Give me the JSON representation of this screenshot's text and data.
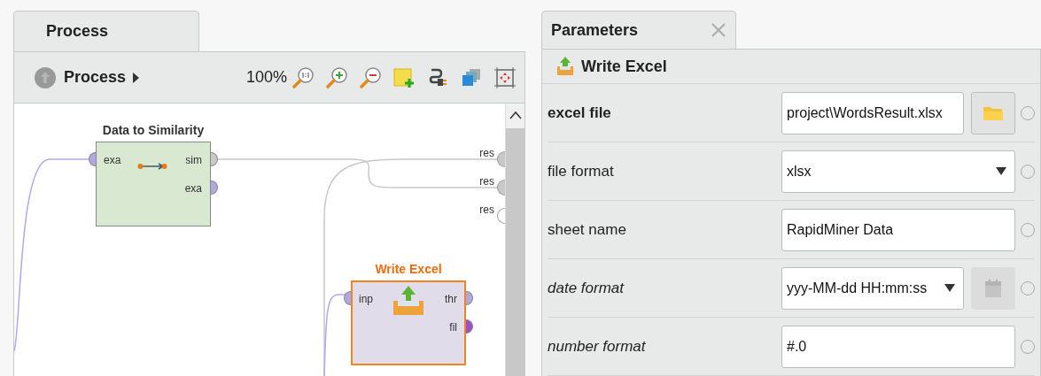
{
  "process_panel": {
    "tab": "Process",
    "toolbar": {
      "breadcrumb": "Process",
      "zoom": "100%"
    },
    "operators": [
      {
        "title": "Data to Similarity",
        "kind": "similarity",
        "selected": false,
        "inputs": [
          {
            "label": "exa",
            "color": "#b0a8e0"
          }
        ],
        "outputs": [
          {
            "label": "sim",
            "color": "#c8c8c8"
          },
          {
            "label": "exa",
            "color": "#b0a8e0"
          }
        ]
      },
      {
        "title": "Write Excel",
        "kind": "write",
        "selected": true,
        "inputs": [
          {
            "label": "inp",
            "color": "#b0a8e0"
          }
        ],
        "outputs": [
          {
            "label": "thr",
            "color": "#b0a8e0"
          },
          {
            "label": "fil",
            "color": "#9a4fc8"
          }
        ]
      }
    ],
    "result_ports": [
      {
        "label": "res",
        "connected": true
      },
      {
        "label": "res",
        "connected": true
      },
      {
        "label": "res",
        "connected": false
      }
    ]
  },
  "parameters_panel": {
    "tab": "Parameters",
    "operator": "Write Excel",
    "parameters": [
      {
        "label": "excel file",
        "mandatory": true,
        "expert": false,
        "kind": "file",
        "value": "project\\WordsResult.xlsx"
      },
      {
        "label": "file format",
        "mandatory": false,
        "expert": false,
        "kind": "select",
        "value": "xlsx"
      },
      {
        "label": "sheet name",
        "mandatory": false,
        "expert": false,
        "kind": "text",
        "value": "RapidMiner Data"
      },
      {
        "label": "date format",
        "mandatory": false,
        "expert": true,
        "kind": "date",
        "value": "yyy-MM-dd HH:mm:ss"
      },
      {
        "label": "number format",
        "mandatory": false,
        "expert": true,
        "kind": "text",
        "value": "#.0"
      }
    ]
  }
}
